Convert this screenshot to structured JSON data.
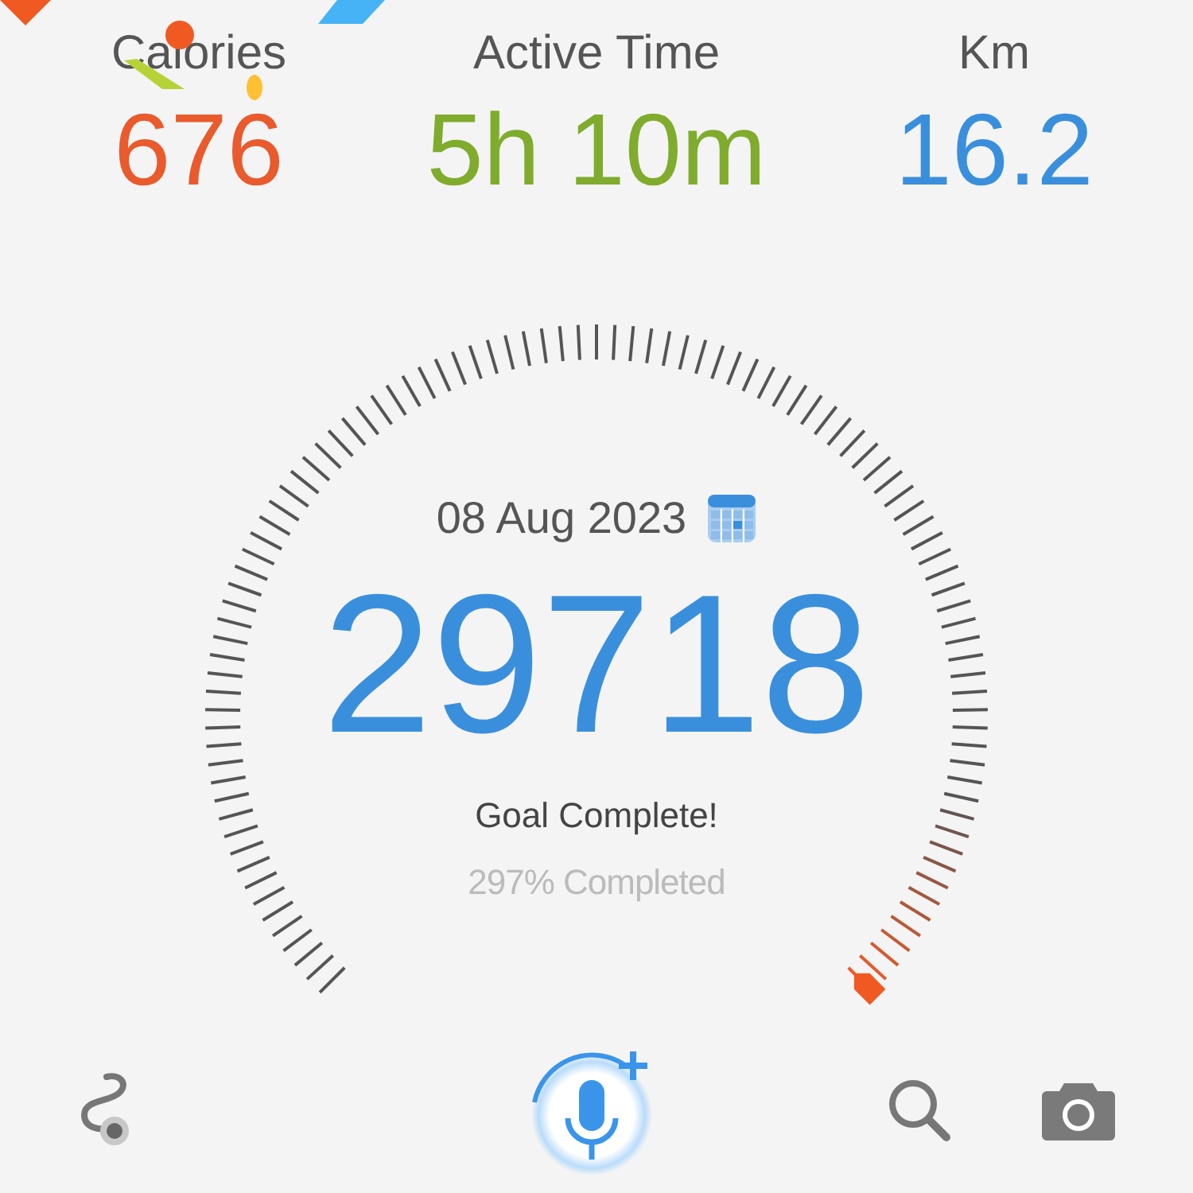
{
  "stats": [
    {
      "label": "Calories",
      "value": "676",
      "color": "#e95a2c"
    },
    {
      "label": "Active Time",
      "value": "5h 10m",
      "color": "#7fac2c"
    },
    {
      "label": "Km",
      "value": "16.2",
      "color": "#3a8fdd"
    }
  ],
  "gauge": {
    "date": "08 Aug 2023",
    "steps": "29718",
    "status": "Goal Complete!",
    "percent": "297% Completed"
  }
}
